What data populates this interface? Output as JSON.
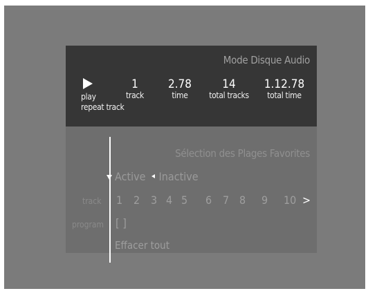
{
  "status": {
    "mode_title": "Mode Disque Audio",
    "play_label": "play",
    "repeat_label": "repeat track",
    "track": {
      "value": "1",
      "label": "track"
    },
    "time": {
      "value": "2.78",
      "label": "time"
    },
    "total_tracks": {
      "value": "14",
      "label": "total tracks"
    },
    "total_time": {
      "value": "1.12.78",
      "label": "total time"
    }
  },
  "favorites": {
    "title": "Sélection des Plages Favorites",
    "active": "Active",
    "inactive": "Inactive",
    "track_label": "track",
    "program_label": "program",
    "tracks": [
      "1",
      "2",
      "3",
      "4",
      "5",
      "6",
      "7",
      "8",
      "9",
      "10"
    ],
    "next": ">",
    "program_value": "[ ]",
    "clear_all": "Effacer tout"
  }
}
